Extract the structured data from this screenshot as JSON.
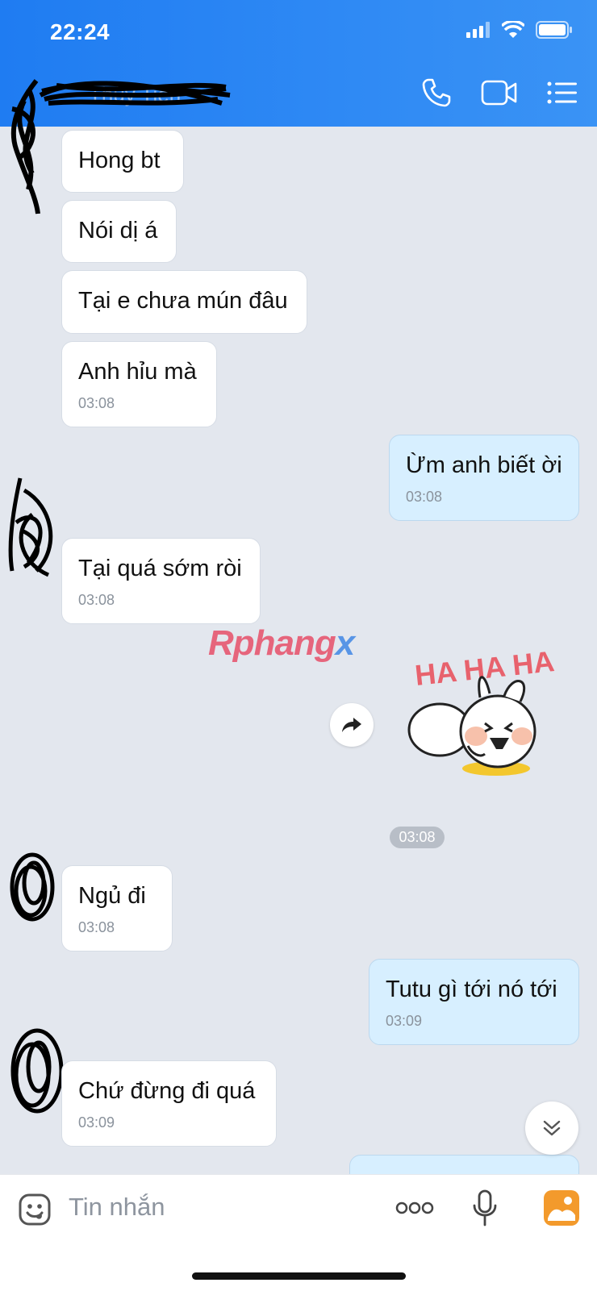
{
  "status_bar": {
    "time": "22:24"
  },
  "header": {
    "contact_name": "Thủy Tiên"
  },
  "messages": [
    {
      "text": "Hong bt",
      "time": ""
    },
    {
      "text": "Nói dị á",
      "time": ""
    },
    {
      "text": "Tại e chưa mún đâu",
      "time": ""
    },
    {
      "text": "Anh hỉu mà",
      "time": "03:08"
    },
    {
      "text": "Ừm anh biết ời",
      "time": "03:08"
    },
    {
      "text": "Tại quá sớm ròi",
      "time": "03:08"
    },
    {
      "text": "Ngủ đi",
      "time": "03:08"
    },
    {
      "text": "Tutu gì tới nó tới",
      "time": "03:09"
    },
    {
      "text": "Chứ đừng đi quá",
      "time": "03:09"
    }
  ],
  "sticker": {
    "time": "03:08",
    "caption": "HA HA HA"
  },
  "watermark": {
    "part1": "Rphang",
    "part2": "x"
  },
  "input": {
    "placeholder": "Tin nhắn"
  },
  "icons": {
    "emoji": "emoji-icon",
    "more": "more-icon",
    "mic": "microphone-icon",
    "gallery": "image-icon",
    "call": "phone-icon",
    "video": "video-call-icon",
    "menu": "list-icon"
  },
  "colors": {
    "header": "#1f7cf2",
    "my_bubble": "#d7efff",
    "background": "#e3e7ee"
  }
}
